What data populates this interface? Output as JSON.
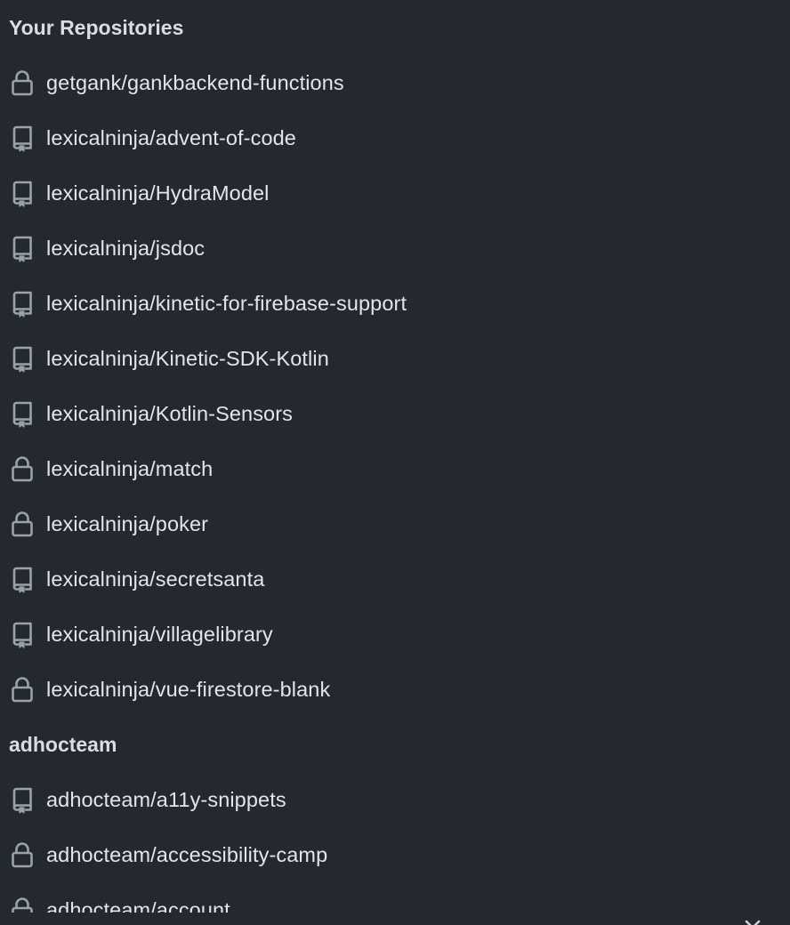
{
  "sections": [
    {
      "title": "Your Repositories",
      "repos": [
        {
          "name": "getgank/gankbackend-functions",
          "icon": "lock-icon"
        },
        {
          "name": "lexicalninja/advent-of-code",
          "icon": "repo-icon"
        },
        {
          "name": "lexicalninja/HydraModel",
          "icon": "repo-icon"
        },
        {
          "name": "lexicalninja/jsdoc",
          "icon": "repo-icon"
        },
        {
          "name": "lexicalninja/kinetic-for-firebase-support",
          "icon": "repo-icon"
        },
        {
          "name": "lexicalninja/Kinetic-SDK-Kotlin",
          "icon": "repo-icon"
        },
        {
          "name": "lexicalninja/Kotlin-Sensors",
          "icon": "repo-icon"
        },
        {
          "name": "lexicalninja/match",
          "icon": "lock-icon"
        },
        {
          "name": "lexicalninja/poker",
          "icon": "lock-icon"
        },
        {
          "name": "lexicalninja/secretsanta",
          "icon": "repo-icon"
        },
        {
          "name": "lexicalninja/villagelibrary",
          "icon": "repo-icon"
        },
        {
          "name": "lexicalninja/vue-firestore-blank",
          "icon": "lock-icon"
        }
      ]
    },
    {
      "title": "adhocteam",
      "repos": [
        {
          "name": "adhocteam/a11y-snippets",
          "icon": "repo-icon"
        },
        {
          "name": "adhocteam/accessibility-camp",
          "icon": "lock-icon"
        },
        {
          "name": "adhocteam/account",
          "icon": "lock-icon"
        }
      ]
    }
  ],
  "close_button_icon": "close-icon",
  "colors": {
    "background": "#24292f",
    "text": "#e2e6ea",
    "icon": "#9aa1a9"
  }
}
